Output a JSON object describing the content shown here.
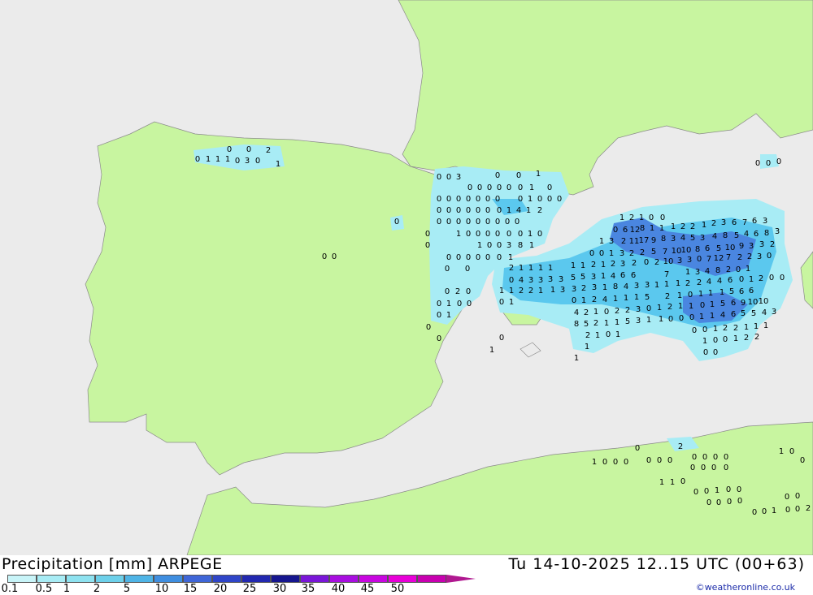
{
  "map": {
    "sea_color": "#ebebeb",
    "land_color": "#c8f5a0",
    "precip_light": "#a8ecf5",
    "precip_medium": "#5bc8ee",
    "precip_heavy": "#4a86e0",
    "values": [
      "0",
      "1",
      "1",
      "1",
      "0",
      "3",
      "0",
      "1",
      "0",
      "0",
      "2",
      "0",
      "0",
      "3",
      "0",
      "0",
      "1",
      "0",
      "0",
      "0",
      "0",
      "0",
      "0",
      "1",
      "0",
      "0",
      "0",
      "0",
      "0",
      "0",
      "0",
      "0",
      "0",
      "1",
      "0",
      "0",
      "0",
      "0",
      "0",
      "0",
      "0",
      "0",
      "0",
      "0",
      "1",
      "4",
      "1",
      "2",
      "0",
      "0",
      "0",
      "0",
      "0",
      "0",
      "0",
      "0",
      "0",
      "0",
      "1",
      "0",
      "0",
      "0",
      "0",
      "0",
      "0",
      "1",
      "0",
      "1",
      "0",
      "0",
      "3",
      "8",
      "1",
      "0",
      "0",
      "0",
      "0",
      "0",
      "0",
      "1",
      "0",
      "0",
      "0",
      "2",
      "0",
      "0",
      "1",
      "0",
      "0",
      "0",
      "1",
      "0",
      "0",
      "0",
      "0",
      "0",
      "1",
      "0",
      "0",
      "1",
      "2",
      "1",
      "0",
      "0",
      "0",
      "6",
      "12",
      "8",
      "1",
      "1",
      "1",
      "2",
      "2",
      "1",
      "2",
      "3",
      "6",
      "7",
      "6",
      "3",
      "1",
      "3",
      "2",
      "11",
      "17",
      "9",
      "8",
      "3",
      "4",
      "5",
      "3",
      "4",
      "8",
      "5",
      "4",
      "6",
      "8",
      "3",
      "0",
      "0",
      "1",
      "3",
      "2",
      "2",
      "5",
      "7",
      "10",
      "10",
      "8",
      "6",
      "5",
      "10",
      "9",
      "3",
      "3",
      "2",
      "2",
      "1",
      "1",
      "1",
      "1",
      "1",
      "1",
      "2",
      "1",
      "2",
      "3",
      "2",
      "0",
      "2",
      "10",
      "3",
      "3",
      "0",
      "7",
      "12",
      "7",
      "2",
      "2",
      "3",
      "0",
      "0",
      "4",
      "3",
      "3",
      "3",
      "3",
      "5",
      "5",
      "3",
      "1",
      "4",
      "6",
      "6",
      "7",
      "1",
      "3",
      "4",
      "8",
      "2",
      "0",
      "1",
      "1",
      "1",
      "2",
      "2",
      "1",
      "1",
      "3",
      "3",
      "2",
      "3",
      "1",
      "8",
      "4",
      "3",
      "3",
      "1",
      "1",
      "1",
      "2",
      "2",
      "4",
      "4",
      "6",
      "0",
      "1",
      "2",
      "0",
      "0",
      "0",
      "1",
      "0",
      "1",
      "2",
      "4",
      "1",
      "1",
      "1",
      "5",
      "2",
      "1",
      "0",
      "1",
      "1",
      "1",
      "5",
      "6",
      "6",
      "4",
      "2",
      "1",
      "0",
      "2",
      "2",
      "3",
      "0",
      "1",
      "2",
      "1",
      "1",
      "0",
      "1",
      "5",
      "6",
      "9",
      "10",
      "10",
      "8",
      "5",
      "2",
      "1",
      "1",
      "5",
      "3",
      "1",
      "1",
      "0",
      "0",
      "0",
      "1",
      "1",
      "4",
      "6",
      "5",
      "5",
      "4",
      "3",
      "2",
      "1",
      "0",
      "1",
      "0",
      "0",
      "1",
      "2",
      "2",
      "1",
      "1",
      "1",
      "1",
      "0",
      "0",
      "1",
      "2",
      "2",
      "1",
      "1",
      "0",
      "0",
      "1",
      "0",
      "0",
      "0",
      "0",
      "0",
      "0",
      "0",
      "2",
      "0",
      "0",
      "0",
      "0",
      "0",
      "0",
      "0",
      "0",
      "1",
      "0",
      "0",
      "1",
      "1",
      "0",
      "0",
      "0",
      "1",
      "0",
      "0",
      "0",
      "0",
      "0",
      "0",
      "0",
      "0",
      "1",
      "0",
      "0",
      "2",
      "0",
      "0",
      "0",
      "0",
      "0"
    ]
  },
  "footer": {
    "title": "Precipitation [mm] ARPEGE",
    "time": "Tu 14-10-2025 12..15 UTC (00+63)",
    "credit": "©weatheronline.co.uk"
  },
  "legend": {
    "colors": [
      "#c8f4f8",
      "#a8ecf5",
      "#8ee2f0",
      "#6dd0ea",
      "#4fb4e6",
      "#3f8ee0",
      "#3f66d8",
      "#2f45c8",
      "#2228b0",
      "#16168f",
      "#7a16d8",
      "#a80ee0",
      "#c806e0",
      "#e800d8",
      "#c800b0",
      "#b01890"
    ],
    "labels": [
      "0.1",
      "0.5",
      "1",
      "2",
      "5",
      "10",
      "15",
      "20",
      "25",
      "30",
      "35",
      "40",
      "45",
      "50"
    ]
  }
}
